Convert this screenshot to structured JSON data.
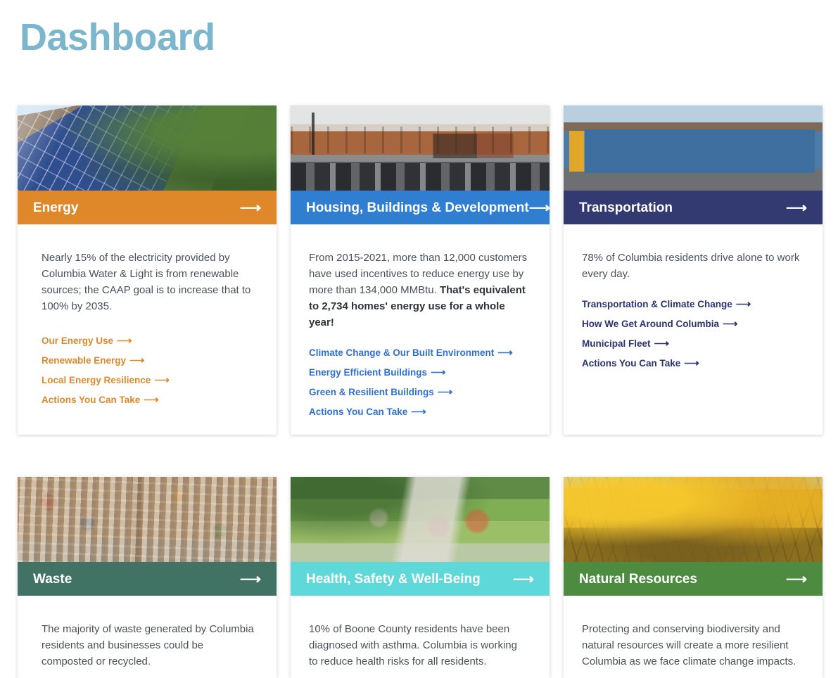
{
  "page": {
    "title": "Dashboard",
    "title_color": "#7bb6cd",
    "background": "#ffffff"
  },
  "cards": [
    {
      "id": "energy",
      "title": "Energy",
      "header_color": "#df8829",
      "link_color": "#df8829",
      "arrow": "⟶",
      "image": "solar-panels-on-roof",
      "text": "Nearly 15% of the electricity provided by Columbia Water & Light is from renewable sources; the CAAP goal is to increase that to 100% by 2035.",
      "text_bold": "",
      "links": [
        {
          "label": "Our Energy Use",
          "arrow": "⟶"
        },
        {
          "label": "Renewable Energy",
          "arrow": "⟶"
        },
        {
          "label": "Local Energy Resilience",
          "arrow": "⟶"
        },
        {
          "label": "Actions You Can Take",
          "arrow": "⟶"
        }
      ]
    },
    {
      "id": "housing",
      "title": "Housing, Buildings & Development",
      "header_color": "#2f7ed1",
      "link_color": "#2f6fd0",
      "arrow": "⟶",
      "image": "downtown-street-with-traffic",
      "text": "From 2015-2021, more than 12,000 customers have used incentives to reduce energy use by more than 134,000 MMBtu. ",
      "text_bold": "That's equivalent to 2,734 homes' energy use for a whole year!",
      "links": [
        {
          "label": "Climate Change & Our Built Environment",
          "arrow": "⟶"
        },
        {
          "label": "Energy Efficient Buildings",
          "arrow": "⟶"
        },
        {
          "label": "Green & Resilient Buildings",
          "arrow": "⟶"
        },
        {
          "label": "Actions You Can Take",
          "arrow": "⟶"
        }
      ]
    },
    {
      "id": "transportation",
      "title": "Transportation",
      "header_color": "#333a72",
      "link_color": "#2b3270",
      "arrow": "⟶",
      "image": "city-transit-bus",
      "text": "78% of Columbia residents drive alone to work every day.",
      "text_bold": "",
      "links": [
        {
          "label": "Transportation & Climate Change",
          "arrow": "⟶"
        },
        {
          "label": "How We Get Around Columbia",
          "arrow": "⟶"
        },
        {
          "label": "Municipal Fleet",
          "arrow": "⟶"
        },
        {
          "label": "Actions You Can Take",
          "arrow": "⟶"
        }
      ]
    },
    {
      "id": "waste",
      "title": "Waste",
      "header_color": "#427263",
      "link_color": "#427263",
      "arrow": "⟶",
      "image": "baled-recyclable-materials",
      "text": "The majority of waste generated by Columbia residents and businesses could be composted or recycled.",
      "text_bold": "",
      "links": []
    },
    {
      "id": "health",
      "title": "Health, Safety & Well-Being",
      "header_color": "#5fd8d9",
      "link_color": "#3fb9ba",
      "arrow": "⟶",
      "image": "children-biking-on-park-path",
      "text": "10% of Boone County residents have been diagnosed with asthma. Columbia is working to reduce health risks for all residents.",
      "text_bold": "",
      "links": []
    },
    {
      "id": "natural-resources",
      "title": "Natural Resources",
      "header_color": "#4d8b40",
      "link_color": "#4d8b40",
      "arrow": "⟶",
      "image": "autumn-tree-canopy",
      "text": "Protecting and conserving biodiversity and natural resources will create a more resilient Columbia as we face climate change impacts.",
      "text_bold": "",
      "links": []
    }
  ]
}
